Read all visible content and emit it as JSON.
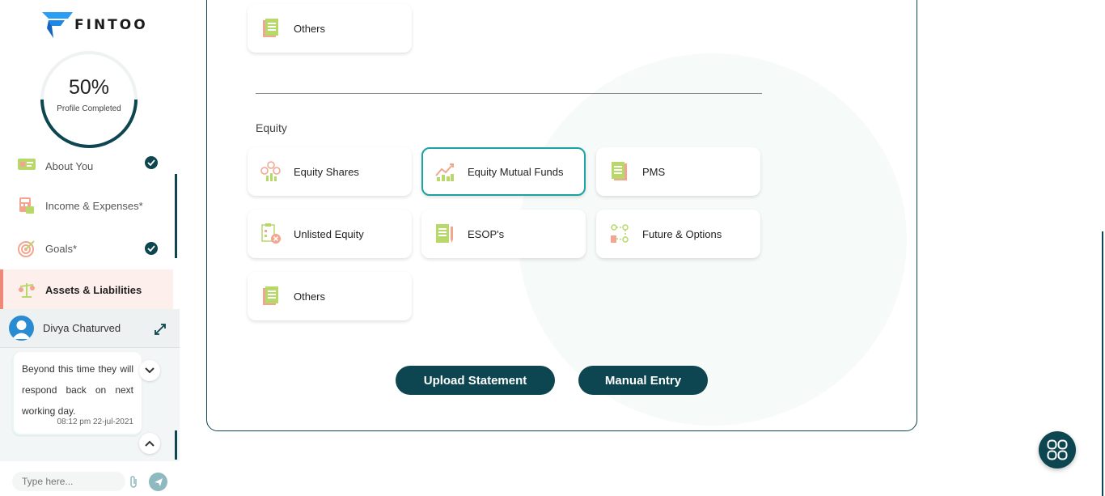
{
  "brand": {
    "name": "FINTOO"
  },
  "profile": {
    "percent": "50%",
    "label": "Profile Completed",
    "fraction": 0.5
  },
  "nav": {
    "about": "About You",
    "income": "Income & Expenses*",
    "goals": "Goals*",
    "assets": "Assets & Liabilities"
  },
  "chat": {
    "name": "Divya Chaturved",
    "message": "Beyond this time they will respond back on next working day.",
    "time": "08:12 pm 22-jul-2021",
    "placeholder": "Type here..."
  },
  "main": {
    "top_others": "Others",
    "equity_title": "Equity",
    "tiles": {
      "equity_shares": "Equity Shares",
      "equity_mf": "Equity Mutual Funds",
      "pms": "PMS",
      "unlisted": "Unlisted Equity",
      "esop": "ESOP's",
      "fno": "Future & Options",
      "others": "Others"
    },
    "upload_btn": "Upload Statement",
    "manual_btn": "Manual Entry"
  },
  "colors": {
    "primary": "#0d4650",
    "accent": "#f0887a",
    "selected": "#1aa3a0"
  }
}
